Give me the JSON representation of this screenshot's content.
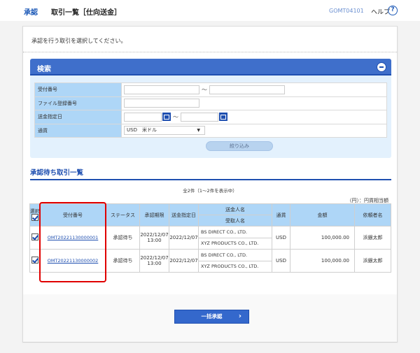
{
  "header": {
    "breadcrumb": "承認",
    "title": "取引一覧［仕向送金］",
    "screen_id": "GOMT04101",
    "help_label": "ヘルプ",
    "help_icon": "?"
  },
  "lead_text": "承認を行う取引を選択してください。",
  "search": {
    "title": "検索",
    "fields": [
      {
        "label": "受付番号",
        "from": "",
        "to": ""
      },
      {
        "label": "ファイル登録番号",
        "value": ""
      },
      {
        "label": "送金指定日",
        "from": "",
        "to": ""
      },
      {
        "label": "通貨",
        "selected": "USD　米ドル"
      }
    ],
    "range_separator": "～",
    "filter_button": "絞り込み"
  },
  "list": {
    "title": "承認待ち取引一覧",
    "count_text": "全2件（1～2件を表示中）",
    "unit_text": "（円）：円貨相当額",
    "headers": {
      "select": "選択",
      "receipt_no": "受付番号",
      "status": "ステータス",
      "deadline": "承認期限",
      "remit_date": "送金指定日",
      "remitter": "送金人名",
      "beneficiary": "受取人名",
      "currency": "通貨",
      "amount": "金額",
      "requester": "依頼者名"
    },
    "rows": [
      {
        "checked": true,
        "receipt_no": "OMT20221130000001",
        "status": "承認待ち",
        "deadline_date": "2022/12/07",
        "deadline_time": "13:00",
        "remit_date": "2022/12/07",
        "remitter": "BS DIRECT CO., LTD.",
        "beneficiary": "XYZ PRODUCTS CO., LTD.",
        "currency": "USD",
        "amount": "100,000.00",
        "requester": "浜銀太郎"
      },
      {
        "checked": true,
        "receipt_no": "OMT20221130000002",
        "status": "承認待ち",
        "deadline_date": "2022/12/07",
        "deadline_time": "13:00",
        "remit_date": "2022/12/07",
        "remitter": "BS DIRECT CO., LTD.",
        "beneficiary": "XYZ PRODUCTS CO., LTD.",
        "currency": "USD",
        "amount": "100,000.00",
        "requester": "浜銀太郎"
      }
    ]
  },
  "footer": {
    "bulk_approve_button": "一括承認",
    "chevron": "›"
  },
  "colors": {
    "accent": "#1f4fb0",
    "header_bar": "#3f6fcb",
    "table_header": "#aed6f7",
    "highlight": "#e00000"
  }
}
